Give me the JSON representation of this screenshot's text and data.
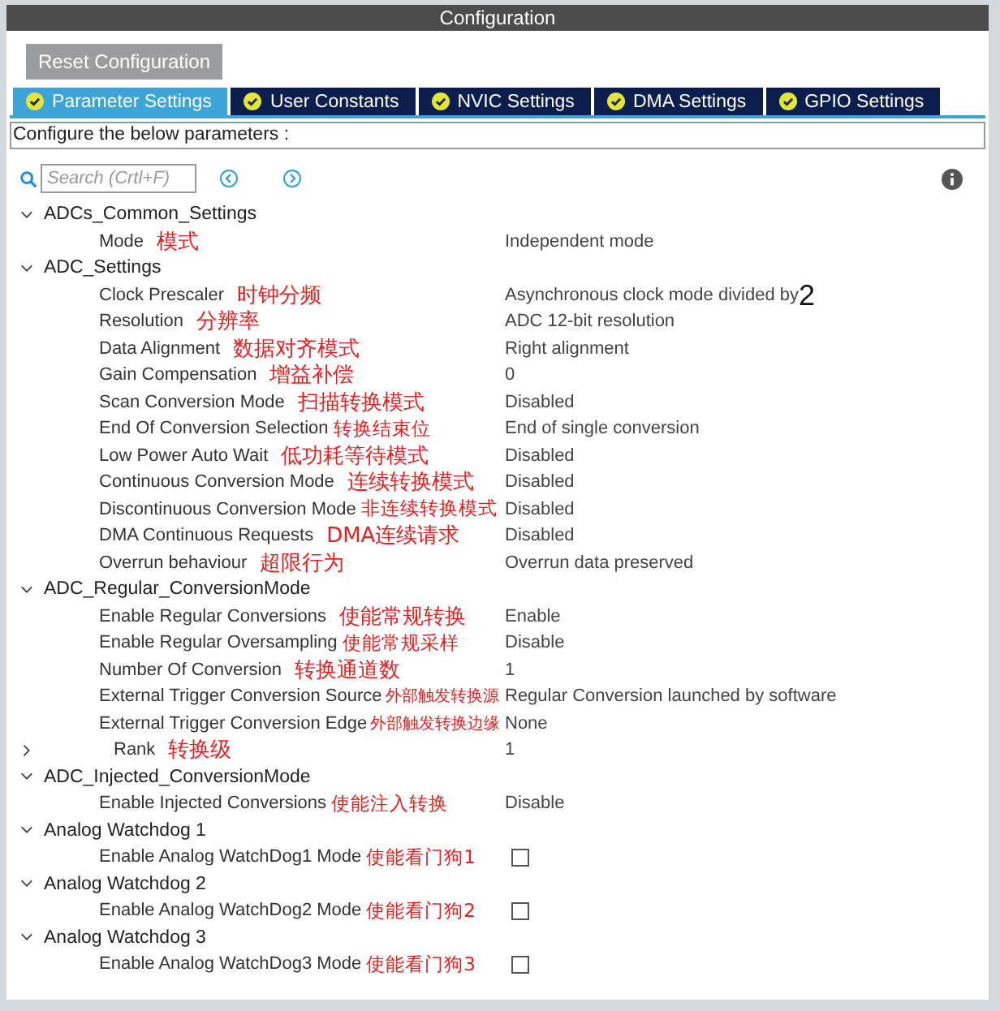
{
  "window": {
    "title": "Configuration"
  },
  "reset_button": "Reset Configuration",
  "tabs": [
    {
      "label": "Parameter Settings",
      "selected": true
    },
    {
      "label": "User Constants",
      "selected": false
    },
    {
      "label": "NVIC Settings",
      "selected": false
    },
    {
      "label": "DMA Settings",
      "selected": false
    },
    {
      "label": "GPIO Settings",
      "selected": false
    }
  ],
  "description": "Configure the below parameters :",
  "search": {
    "placeholder": "Search (Crtl+F)"
  },
  "groups": [
    {
      "title": "ADCs_Common_Settings",
      "expanded": true,
      "items": [
        {
          "kind": "text",
          "name": "Mode",
          "note": "模式",
          "value": "Independent mode"
        }
      ]
    },
    {
      "title": "ADC_Settings",
      "expanded": true,
      "items": [
        {
          "kind": "text",
          "name": "Clock Prescaler",
          "note": "时钟分频",
          "value": "Asynchronous clock mode divided by",
          "value_note": "2"
        },
        {
          "kind": "text",
          "name": "Resolution",
          "note": "分辨率",
          "value": "ADC 12-bit resolution"
        },
        {
          "kind": "text",
          "name": "Data Alignment",
          "note": "数据对齐模式",
          "value": "Right alignment"
        },
        {
          "kind": "text",
          "name": "Gain Compensation",
          "note": "增益补偿",
          "value": "0"
        },
        {
          "kind": "text",
          "name": "Scan Conversion Mode",
          "note": "扫描转换模式",
          "value": "Disabled"
        },
        {
          "kind": "text",
          "name": "End Of Conversion Selection",
          "note": "转换结束位",
          "value": "End of single conversion"
        },
        {
          "kind": "text",
          "name": "Low Power Auto Wait",
          "note": "低功耗等待模式",
          "value": "Disabled"
        },
        {
          "kind": "text",
          "name": "Continuous Conversion Mode",
          "note": "连续转换模式",
          "value": "Disabled"
        },
        {
          "kind": "text",
          "name": "Discontinuous Conversion Mode",
          "note": "非连续转换模式",
          "value": "Disabled"
        },
        {
          "kind": "text",
          "name": "DMA Continuous Requests",
          "note": "DMA连续请求",
          "value": "Disabled"
        },
        {
          "kind": "text",
          "name": "Overrun behaviour",
          "note": "超限行为",
          "value": "Overrun data preserved"
        }
      ]
    },
    {
      "title": "ADC_Regular_ConversionMode",
      "expanded": true,
      "items": [
        {
          "kind": "text",
          "name": "Enable Regular Conversions",
          "note": "使能常规转换",
          "value": "Enable"
        },
        {
          "kind": "text",
          "name": "Enable Regular Oversampling",
          "note": "使能常规采样",
          "value": "Disable"
        },
        {
          "kind": "text",
          "name": "Number Of Conversion",
          "note": "转换通道数",
          "value": "1"
        },
        {
          "kind": "text",
          "name": "External Trigger Conversion Source",
          "note": "外部触发转换源",
          "value": "Regular Conversion launched by software"
        },
        {
          "kind": "text",
          "name": "External Trigger Conversion Edge",
          "note": "外部触发转换边缘",
          "value": "None"
        },
        {
          "kind": "subgroup",
          "name": "Rank",
          "note": "转换级",
          "value": "1",
          "expanded": false
        }
      ]
    },
    {
      "title": "ADC_Injected_ConversionMode",
      "expanded": true,
      "items": [
        {
          "kind": "text",
          "name": "Enable Injected Conversions",
          "note": "使能注入转换",
          "value": "Disable"
        }
      ]
    },
    {
      "title": "Analog Watchdog 1",
      "expanded": true,
      "items": [
        {
          "kind": "checkbox",
          "name": "Enable Analog WatchDog1 Mode",
          "note": "使能看门狗1",
          "checked": false
        }
      ]
    },
    {
      "title": "Analog Watchdog 2",
      "expanded": true,
      "items": [
        {
          "kind": "checkbox",
          "name": "Enable Analog WatchDog2 Mode",
          "note": "使能看门狗2",
          "checked": false
        }
      ]
    },
    {
      "title": "Analog Watchdog 3",
      "expanded": true,
      "items": [
        {
          "kind": "checkbox",
          "name": "Enable Analog WatchDog3 Mode",
          "note": "使能看门狗3",
          "checked": false
        }
      ]
    }
  ]
}
